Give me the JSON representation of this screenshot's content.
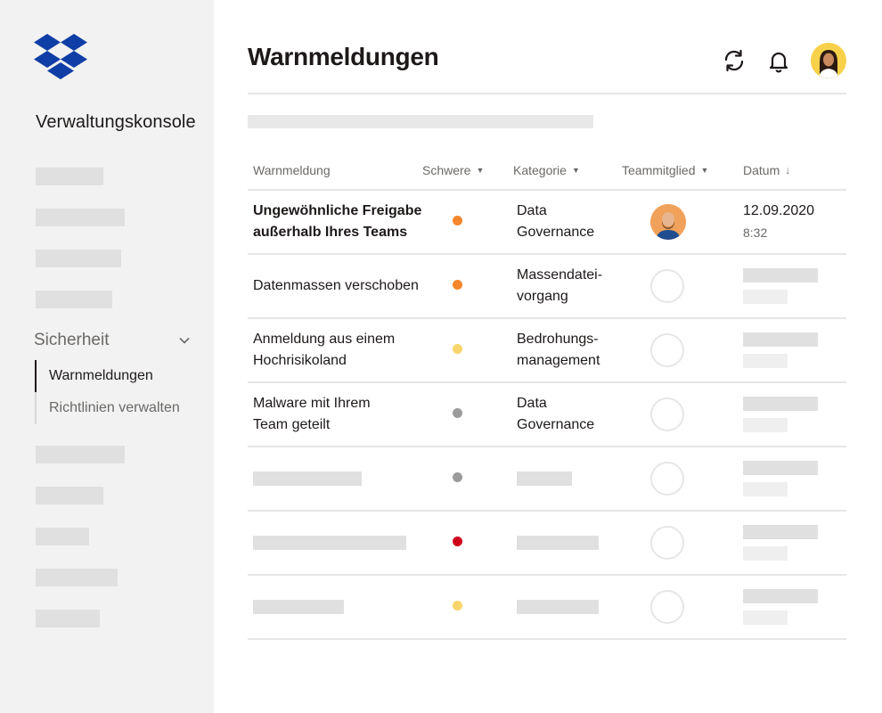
{
  "sidebar": {
    "app_title": "Verwaltungskonsole",
    "section_label": "Sicherheit",
    "sub_items": [
      {
        "label": "Warnmeldungen",
        "active": true
      },
      {
        "label": "Richtlinien verwalten",
        "active": false
      }
    ]
  },
  "header": {
    "title": "Warnmeldungen",
    "icons": [
      "refresh-icon",
      "bell-icon",
      "user-avatar"
    ]
  },
  "table": {
    "columns": [
      "Warnmeldung",
      "Schwere",
      "Kategorie",
      "Teammitglied",
      "Datum"
    ],
    "rows": [
      {
        "alert_line1": "Ungewöhnliche Freigabe",
        "alert_line2": "außerhalb Ihres Teams",
        "severity_color": "#f5862b",
        "category_line1": "Data",
        "category_line2": "Governance",
        "date": "12.09.2020",
        "time": "8:32",
        "has_member": true
      },
      {
        "alert_line1": "Datenmassen verschoben",
        "alert_line2": "",
        "severity_color": "#f5862b",
        "category_line1": "Massendatei-",
        "category_line2": "vorgang"
      },
      {
        "alert_line1": "Anmeldung aus einem",
        "alert_line2": "Hochrisikoland",
        "severity_color": "#f9d56b",
        "category_line1": "Bedrohungs-",
        "category_line2": "management"
      },
      {
        "alert_line1": "Malware mit Ihrem",
        "alert_line2": "Team geteilt",
        "severity_color": "#9b9b9b",
        "category_line1": "Data",
        "category_line2": "Governance"
      }
    ],
    "placeholder_row_severity_colors": [
      "#9b9b9b",
      "#d0021b",
      "#f9d56b"
    ]
  },
  "colors": {
    "brand": "#0f3ea6",
    "sidebar_bg": "#f2f2f2",
    "placeholder": "#e0e0e0"
  }
}
